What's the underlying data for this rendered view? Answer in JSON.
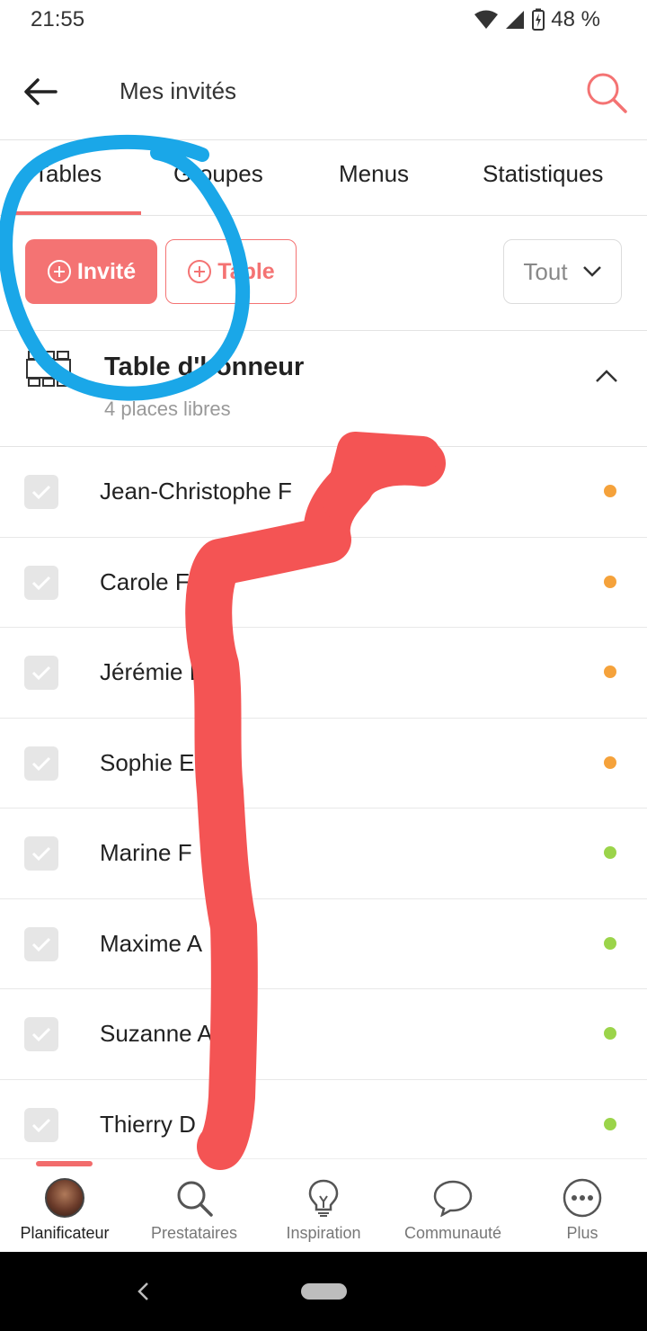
{
  "status_bar": {
    "time": "21:55",
    "battery": "48 %"
  },
  "app_bar": {
    "title": "Mes invités",
    "back_icon": "arrow-left-icon",
    "search_icon": "search-icon"
  },
  "tabs": [
    {
      "label": "Tables",
      "active": true
    },
    {
      "label": "Groupes",
      "active": false
    },
    {
      "label": "Menus",
      "active": false
    },
    {
      "label": "Statistiques",
      "active": false
    }
  ],
  "actions": {
    "invite_label": "Invité",
    "table_label": "Table",
    "filter_value": "Tout"
  },
  "table": {
    "name": "Table d'honneur",
    "places": "4 places libres"
  },
  "guests": [
    {
      "name": "Jean-Christophe F",
      "status_color": "#f5a23b"
    },
    {
      "name": "Carole F",
      "status_color": "#f5a23b"
    },
    {
      "name": "Jérémie E",
      "status_color": "#f5a23b"
    },
    {
      "name": "Sophie E",
      "status_color": "#f5a23b"
    },
    {
      "name": "Marine F",
      "status_color": "#9bd44a"
    },
    {
      "name": "Maxime A",
      "status_color": "#9bd44a"
    },
    {
      "name": "Suzanne A",
      "status_color": "#9bd44a"
    },
    {
      "name": "Thierry D",
      "status_color": "#9bd44a"
    }
  ],
  "bottom_nav": [
    {
      "label": "Planificateur",
      "icon": "avatar",
      "active": true
    },
    {
      "label": "Prestataires",
      "icon": "search-icon",
      "active": false
    },
    {
      "label": "Inspiration",
      "icon": "lightbulb-icon",
      "active": false
    },
    {
      "label": "Communauté",
      "icon": "chat-bubble-icon",
      "active": false
    },
    {
      "label": "Plus",
      "icon": "more-icon",
      "active": false
    }
  ],
  "colors": {
    "accent": "#f47373",
    "annotation_blue": "#1aa7e8",
    "redaction_red": "#f45454"
  }
}
